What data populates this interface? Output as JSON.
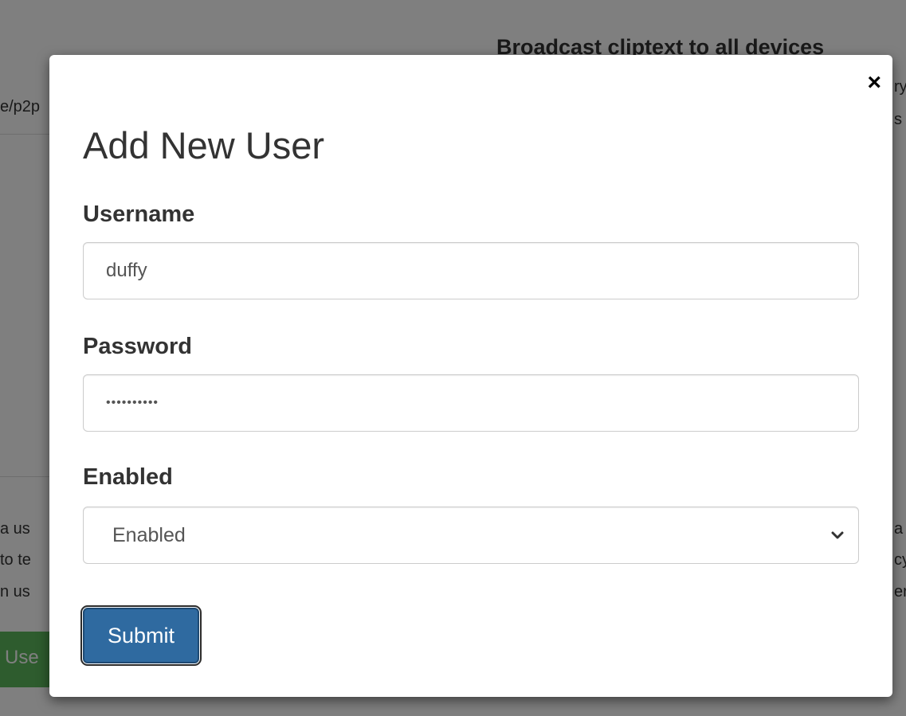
{
  "background": {
    "heading": "Broadcast cliptext to all devices",
    "left_fragments": [
      "e/p2p",
      "a us",
      "to te",
      "n us"
    ],
    "right_fragments": [
      "ry",
      "s",
      "a",
      "cy",
      "er"
    ],
    "green_button_label": "Use"
  },
  "modal": {
    "title": "Add New User",
    "close_symbol": "×",
    "username": {
      "label": "Username",
      "value": "duffy"
    },
    "password": {
      "label": "Password",
      "masked_value": "••••••••••"
    },
    "enabled": {
      "label": "Enabled",
      "selected": "Enabled"
    },
    "submit_label": "Submit"
  },
  "colors": {
    "primary_button": "#2f6aa0",
    "success_button": "#5cb85c"
  }
}
